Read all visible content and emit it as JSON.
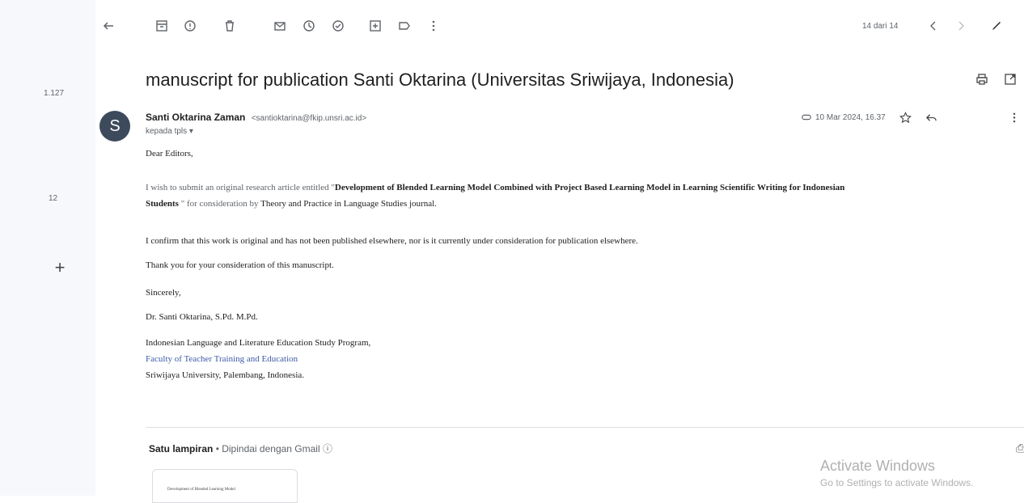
{
  "rail": {
    "count_1": "1.127",
    "count_2": "12",
    "plus": "+"
  },
  "toolbar": {
    "pager": "14 dari 14",
    "icons": [
      "back-arrow-icon",
      "archive-icon",
      "report-spam-icon",
      "delete-icon",
      "mark-unread-icon",
      "snooze-icon",
      "add-task-icon",
      "move-to-icon",
      "label-icon",
      "more-vert-icon",
      "prev-icon",
      "next-icon",
      "edit-icon"
    ]
  },
  "subject": "manuscript for publication Santi Oktarina (Universitas Sriwijaya, Indonesia)",
  "sender": {
    "avatar_letter": "S",
    "name": "Santi Oktarina Zaman",
    "email": "<santioktarina@fkip.unsri.ac.id>",
    "recipient": "kepada tpls ▾",
    "date": "10 Mar 2024, 16.37"
  },
  "body": {
    "greeting": "Dear Editors,",
    "p1_pre": "I wish to submit an original research article entitled \"",
    "p1_title_a": "Development of Blended Learning Model Combined with Project Based Learning Model in Learning Scientific Writing for Indonesian",
    "p1_title_b": "Students",
    "p1_post_a": "\" for consideration by",
    "p1_post_b": "Theory and Practice in Language Studies journal.",
    "p2": "I confirm that this work is original and has not been published elsewhere, nor is it currently under consideration for publication elsewhere.",
    "p3": "Thank you for your consideration of this manuscript.",
    "closing": "Sincerely,",
    "signature_name": "Dr. Santi Oktarina, S.Pd. M.Pd.",
    "sig_line1": "Indonesian Language and Literature Education Study Program,",
    "sig_line2": "Faculty of Teacher Training and Education",
    "sig_line3": "Sriwijaya University, Palembang,  Indonesia."
  },
  "attachment": {
    "title": "Satu lampiran",
    "subtitle": " • Dipindai dengan Gmail ⓘ",
    "thumb_text": "Development of Blended Learning Model"
  },
  "watermark": {
    "title": "Activate Windows",
    "subtitle": "Go to Settings to activate Windows."
  }
}
